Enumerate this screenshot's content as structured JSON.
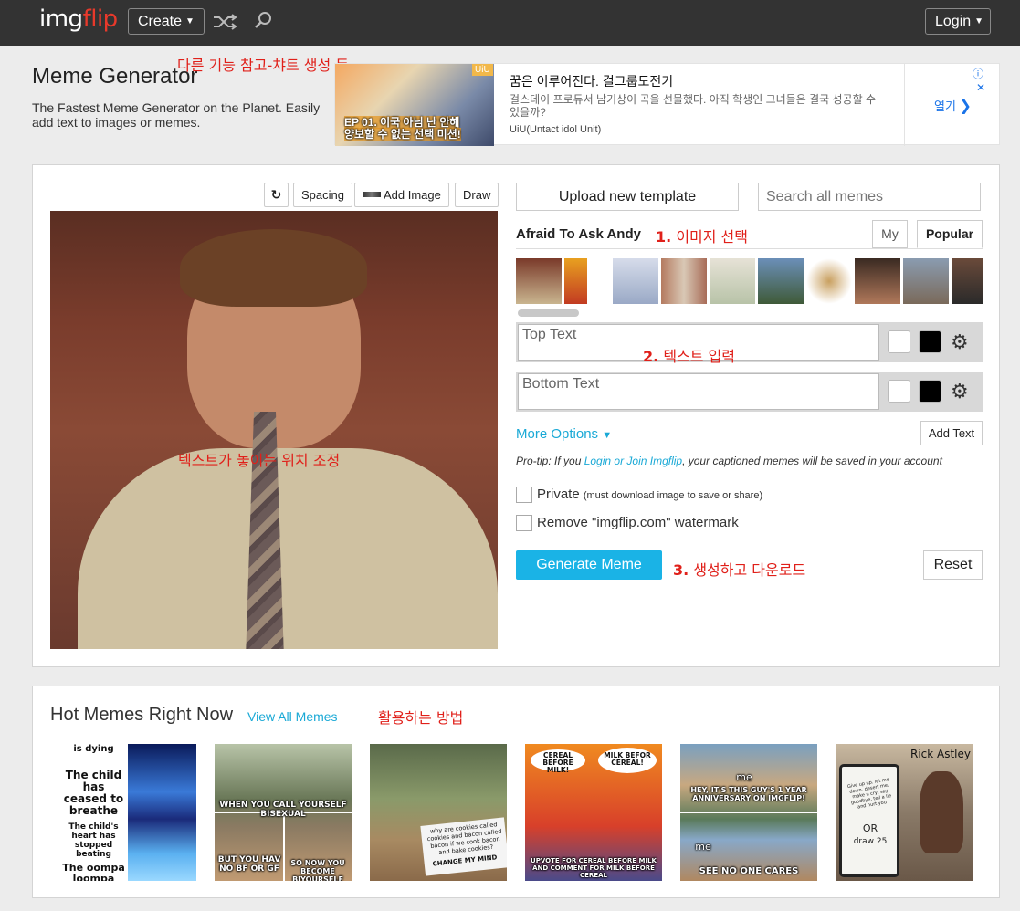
{
  "nav": {
    "logo_part1": "img",
    "logo_part2": "flip",
    "create_label": "Create",
    "login_label": "Login"
  },
  "header": {
    "title": "Meme Generator",
    "subtitle": "The Fastest Meme Generator on the Planet. Easily add text to images or memes."
  },
  "annotations": {
    "top_note": "다른 기능 참고-챠트 생성 등",
    "step1_num": "1.",
    "step1_text": "이미지 선택",
    "step2_num": "2.",
    "step2_text": "텍스트 입력",
    "step3_num": "3.",
    "step3_text": "생성하고 다운로드",
    "image_note": "텍스트가 놓이는 위치 조정",
    "hot_note": "활용하는 방법"
  },
  "ad": {
    "tag": "UiU",
    "image_caption_1": "EP 01. 이국 아님 난 안해",
    "image_caption_2": "양보할 수 없는 선택 미션!",
    "headline": "꿈은 이루어진다. 걸그룹도전기",
    "body": "걸스데이 프로듀서 남기상이 곡을 선물했다. 아직 학생인 그녀들은 결국 성공할 수 있을까?",
    "source": "UiU(Untact idol Unit)",
    "open_label": "열기",
    "info_icon": "ⓘ",
    "close_icon": "✕"
  },
  "editor": {
    "rotate_icon": "rotate-icon",
    "spacing_label": "Spacing",
    "add_image_label": "Add Image",
    "draw_label": "Draw",
    "upload_label": "Upload new template",
    "search_placeholder": "Search all memes",
    "template_name": "Afraid To Ask Andy",
    "tab_my": "My",
    "tab_popular": "Popular",
    "top_text_placeholder": "Top Text",
    "bottom_text_placeholder": "Bottom Text",
    "more_options_label": "More Options",
    "add_text_label": "Add Text",
    "protip_prefix": "Pro-tip: If you ",
    "protip_link": "Login or Join Imgflip",
    "protip_suffix": ", your captioned memes will be saved in your account",
    "private_label": "Private",
    "private_note": "(must download image to save or share)",
    "watermark_label": "Remove \"imgflip.com\" watermark",
    "generate_label": "Generate Meme",
    "reset_label": "Reset",
    "swatch_colors": [
      "#ffffff",
      "#000000"
    ]
  },
  "hot": {
    "title": "Hot Memes Right Now",
    "view_all": "View All Memes",
    "memes": [
      {
        "texts": [
          "is dying",
          "The child has ceased to breathe",
          "The child's heart has stopped beating",
          "The oompa loompa"
        ]
      },
      {
        "texts": [
          "WHEN YOU CALL YOURSELF BISEXUAL",
          "BUT YOU HAV NO BF OR GF",
          "SO NOW YOU BECOME BIYOURSELF"
        ]
      },
      {
        "texts": [
          "why are cookies called cookies and bacon called bacon if we cook bacon and bake cookies?",
          "CHANGE MY MIND"
        ]
      },
      {
        "texts": [
          "CEREAL BEFORE MILK!",
          "MILK BEFOR CEREAL!",
          "UPVOTE FOR CEREAL BEFORE MILK AND COMMENT FOR MILK BEFORE CEREAL"
        ]
      },
      {
        "texts": [
          "me",
          "HEY, IT'S THIS GUY'S 1 YEAR ANNIVERSARY ON IMGFLIP!",
          "me",
          "SEE NO ONE CARES"
        ]
      },
      {
        "texts": [
          "Rick Astley",
          "Give up up. let me down, desert me, make u cry, say goodbye, tell a lie and hurt you",
          "OR",
          "draw 25"
        ]
      }
    ]
  }
}
